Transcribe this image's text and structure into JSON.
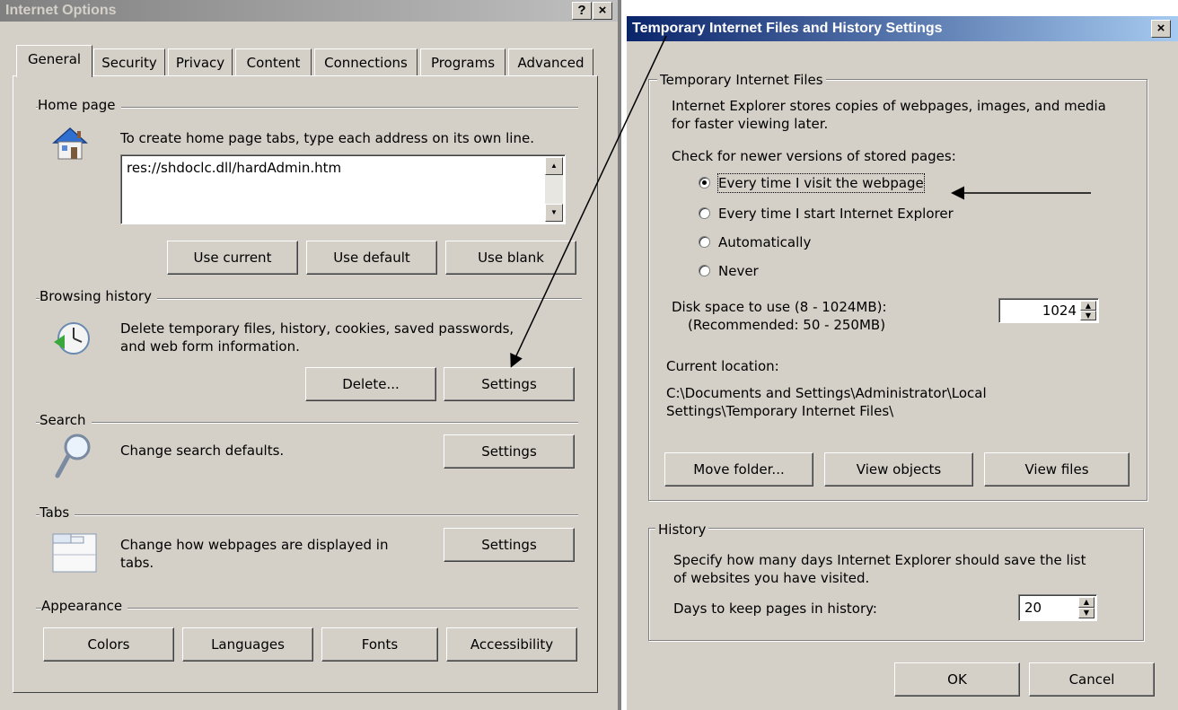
{
  "internet_options": {
    "title": "Internet Options",
    "help_btn": "?",
    "close_btn": "×",
    "tabs": [
      "General",
      "Security",
      "Privacy",
      "Content",
      "Connections",
      "Programs",
      "Advanced"
    ],
    "home_page": {
      "heading": "Home page",
      "description": "To create home page tabs, type each address on its own line.",
      "address_value": "res://shdoclc.dll/hardAdmin.htm",
      "use_current": "Use current",
      "use_default": "Use default",
      "use_blank": "Use blank"
    },
    "browsing_history": {
      "heading": "Browsing history",
      "description_line1": "Delete temporary files, history, cookies, saved passwords,",
      "description_line2": "and web form information.",
      "delete_btn": "Delete...",
      "settings_btn": "Settings"
    },
    "search": {
      "heading": "Search",
      "description": "Change search defaults.",
      "settings_btn": "Settings"
    },
    "tabs_section": {
      "heading": "Tabs",
      "description_line1": "Change how webpages are displayed in",
      "description_line2": "tabs.",
      "settings_btn": "Settings"
    },
    "appearance": {
      "heading": "Appearance",
      "colors_btn": "Colors",
      "languages_btn": "Languages",
      "fonts_btn": "Fonts",
      "accessibility_btn": "Accessibility"
    }
  },
  "tif_settings": {
    "title": "Temporary Internet Files and History Settings",
    "close_btn": "×",
    "temp_files": {
      "group_label": "Temporary Internet Files",
      "description_line1": "Internet Explorer stores copies of webpages, images, and media",
      "description_line2": "for faster viewing later.",
      "check_label": "Check for newer versions of stored pages:",
      "options": [
        {
          "label": "Every time I visit the webpage",
          "checked": true
        },
        {
          "label": "Every time I start Internet Explorer",
          "checked": false
        },
        {
          "label": "Automatically",
          "checked": false
        },
        {
          "label": "Never",
          "checked": false
        }
      ],
      "disk_space_label": "Disk space to use (8 - 1024MB):",
      "disk_space_recommended": "(Recommended: 50 - 250MB)",
      "disk_space_value": "1024",
      "current_location_label": "Current location:",
      "current_location_line1": "C:\\Documents and Settings\\Administrator\\Local",
      "current_location_line2": "Settings\\Temporary Internet Files\\",
      "move_folder_btn": "Move folder...",
      "view_objects_btn": "View objects",
      "view_files_btn": "View files"
    },
    "history": {
      "group_label": "History",
      "description_line1": "Specify how many days Internet Explorer should save the list",
      "description_line2": "of websites you have visited.",
      "days_label": "Days to keep pages in history:",
      "days_value": "20"
    },
    "ok_btn": "OK",
    "cancel_btn": "Cancel"
  },
  "colors": {
    "active_title_bg": "#0a246a",
    "inactive_title_bg": "#808080",
    "dialog_face": "#d4d0c8"
  }
}
